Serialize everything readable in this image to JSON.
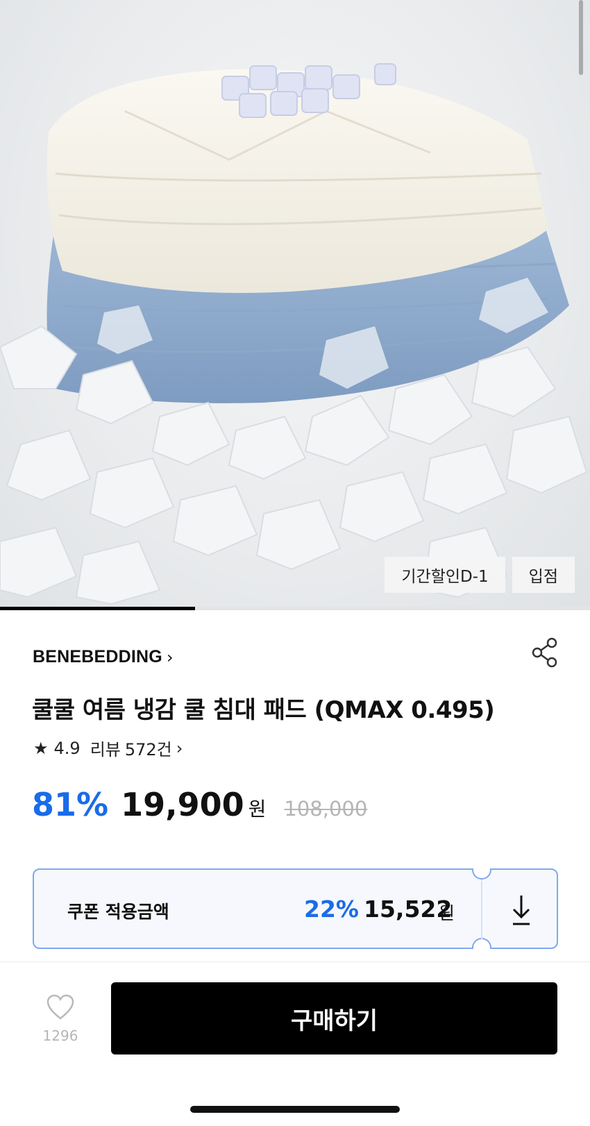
{
  "hero": {
    "badges": [
      "기간할인D-1",
      "입점"
    ],
    "image_progress": 0.33
  },
  "product": {
    "brand": "BENEBEDDING",
    "title": "쿨쿨 여름 냉감 쿨 침대 패드 (QMAX 0.495)",
    "rating": "4.9",
    "review_label": "리뷰",
    "review_count": "572건"
  },
  "price": {
    "discount": "81%",
    "value": "19,900",
    "currency": "원",
    "original": "108,000"
  },
  "coupon": {
    "label": "쿠폰 적용금액",
    "discount": "22%",
    "price": "15,522",
    "currency": "원"
  },
  "bottom_bar": {
    "like_count": "1296",
    "buy_label": "구매하기"
  },
  "colors": {
    "accent": "#1a6ce8",
    "coupon_border": "#7ea9f0",
    "buy_button": "#000000"
  },
  "icons": [
    "chevron-right-icon",
    "share-icon",
    "star-icon",
    "download-icon",
    "heart-icon"
  ]
}
